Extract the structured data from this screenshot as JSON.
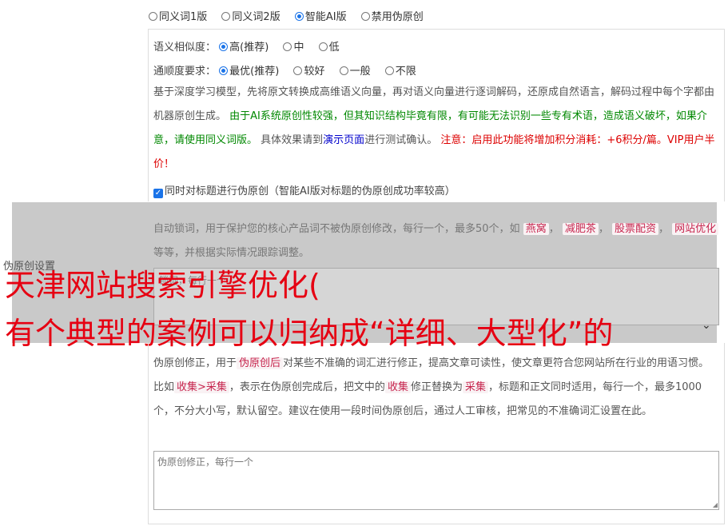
{
  "mode_options": [
    "同义词1版",
    "同义词2版",
    "智能AI版",
    "禁用伪原创"
  ],
  "similarity": {
    "label": "语义相似度：",
    "options": [
      "高(推荐)",
      "中",
      "低"
    ]
  },
  "fluency": {
    "label": "通顺度要求：",
    "options": [
      "最优(推荐)",
      "较好",
      "一般",
      "不限"
    ]
  },
  "description": {
    "p1": "基于深度学习模型，先将原文转换成高维语义向量，再对语义向量进行逐词解码，还原成自然语言，解码过程中每个字都由机器原创生成。",
    "p2_green": "由于AI系统原创性较强，但其知识结构毕竟有限，有可能无法识别一些专有术语，造成语义破坏，如果介意，请使用同义词版。",
    "p3_a": "具体效果请到",
    "p3_link": "演示页面",
    "p3_b": "进行测试确认。",
    "p4_red": "注意：启用此功能将增加积分消耗：+6积分/篇。VIP用户半价！"
  },
  "title_checkbox": "同时对标题进行伪原创（智能AI版对标题的伪原创成功率较高）",
  "lock_words": {
    "text_a": "自动锁词，用于保护您的核心产品词不被伪原创修改，每行一个，最多50个，如",
    "tags": [
      "燕窝",
      "减肥茶",
      "股票配资",
      "网站优化"
    ],
    "text_b": "等等，并根据实际情况跟踪调整。",
    "placeholder": "锁词，每行一个"
  },
  "side_label": "伪原创设置",
  "ad_overlay": {
    "line1": "天津网站搜索引擎优化(",
    "line2": "有个典型的案例可以归纳成“详细、大型化”的"
  },
  "correction": {
    "text_a": "伪原创修正，用于",
    "tag1": "伪原创后",
    "text_b": "对某些不准确的词汇进行修正，提高文章可读性，使文章更符合您网站所在行业的用语习惯。比如",
    "tag2": "收集>采集",
    "text_c": "，表示在伪原创完成后，把文中的",
    "tag3": "收集",
    "text_d": "修正替换为",
    "tag4": "采集",
    "text_e": "，标题和正文同时适用，每行一个，最多1000个，不分大小写，默认留空。建议在使用一段时间伪原创后，通过人工审核，把常见的不准确词汇设置在此。",
    "placeholder": "伪原创修正，每行一个"
  },
  "colors": {
    "accent": "#1a73e8",
    "green": "#008800",
    "red": "#dd0000",
    "overlay": "#c9c9c9",
    "ad_text": "#e60012"
  }
}
